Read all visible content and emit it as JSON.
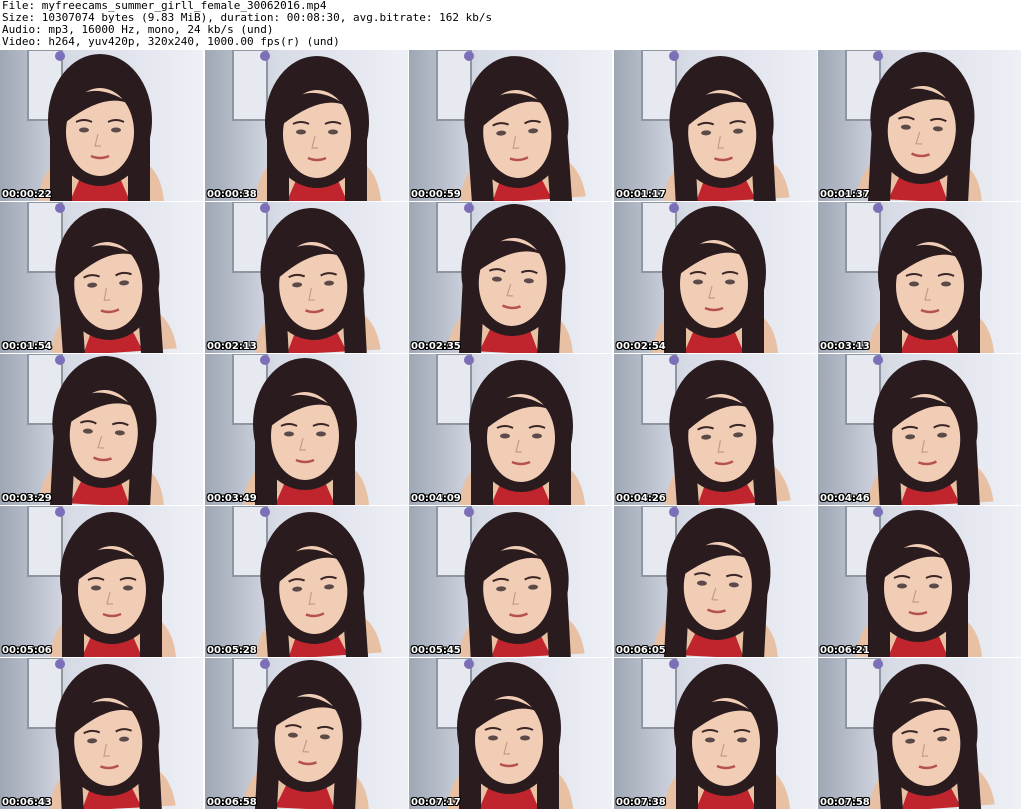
{
  "header": {
    "file_line": "File: myfreecams_summer_girll_female_30062016.mp4",
    "size_line": "Size: 10307074 bytes (9.83 MiB), duration: 00:08:30, avg.bitrate: 162 kb/s",
    "audio_line": "Audio: mp3, 16000 Hz, mono, 24 kb/s (und)",
    "video_line": "Video: h264, yuv420p, 320x240, 1000.00 fps(r) (und)"
  },
  "thumbnails": [
    {
      "timestamp": "00:00:22"
    },
    {
      "timestamp": "00:00:38"
    },
    {
      "timestamp": "00:00:59"
    },
    {
      "timestamp": "00:01:17"
    },
    {
      "timestamp": "00:01:37"
    },
    {
      "timestamp": "00:01:54"
    },
    {
      "timestamp": "00:02:13"
    },
    {
      "timestamp": "00:02:35"
    },
    {
      "timestamp": "00:02:54"
    },
    {
      "timestamp": "00:03:13"
    },
    {
      "timestamp": "00:03:29"
    },
    {
      "timestamp": "00:03:49"
    },
    {
      "timestamp": "00:04:09"
    },
    {
      "timestamp": "00:04:26"
    },
    {
      "timestamp": "00:04:46"
    },
    {
      "timestamp": "00:05:06"
    },
    {
      "timestamp": "00:05:28"
    },
    {
      "timestamp": "00:05:45"
    },
    {
      "timestamp": "00:06:05"
    },
    {
      "timestamp": "00:06:21"
    },
    {
      "timestamp": "00:06:43"
    },
    {
      "timestamp": "00:06:58"
    },
    {
      "timestamp": "00:07:17"
    },
    {
      "timestamp": "00:07:38"
    },
    {
      "timestamp": "00:07:58"
    }
  ]
}
